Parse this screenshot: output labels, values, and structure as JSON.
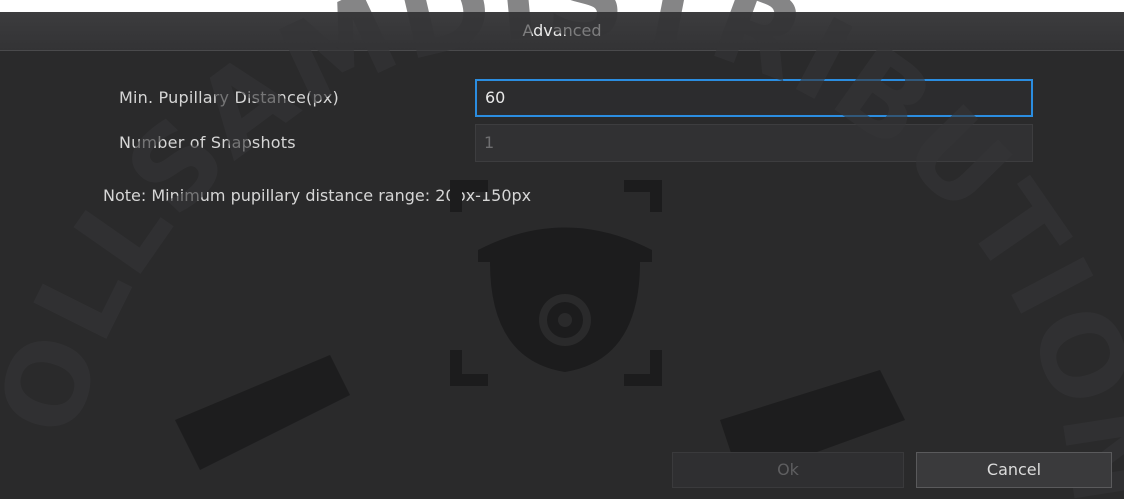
{
  "dialog": {
    "title": "Advanced",
    "fields": [
      {
        "label": "Min. Pupillary Distance(px)",
        "value": "60",
        "state": "focused"
      },
      {
        "label": "Number of Snapshots",
        "value": "1",
        "state": "disabled"
      }
    ],
    "note": "Note: Minimum pupillary distance range: 20px-150px",
    "buttons": {
      "ok": "Ok",
      "cancel": "Cancel"
    }
  },
  "watermark": {
    "text": "OLLSAMDISTRIBUTION, INC"
  },
  "colors": {
    "background": "#2a2a2b",
    "focus_border": "#2b8de0",
    "text": "#d6d6d6"
  }
}
